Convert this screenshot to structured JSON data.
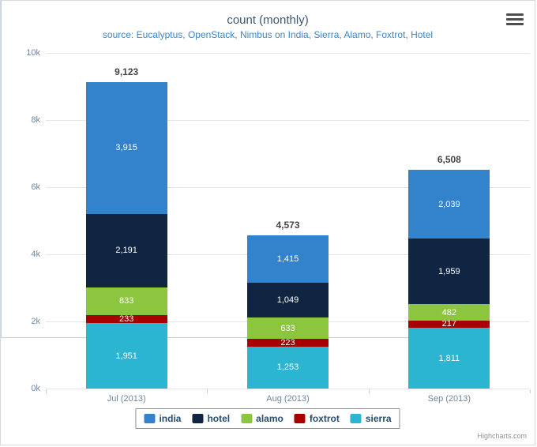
{
  "chart_data": {
    "type": "bar",
    "stacked": true,
    "title": "count (monthly)",
    "subtitle": "source: Eucalyptus, OpenStack, Nimbus on India, Sierra, Alamo, Foxtrot, Hotel",
    "xlabel": "",
    "ylabel": "",
    "categories": [
      "Jul (2013)",
      "Aug (2013)",
      "Sep (2013)"
    ],
    "ylim": [
      0,
      10000
    ],
    "yticks": [
      0,
      2000,
      4000,
      6000,
      8000,
      10000
    ],
    "ytick_labels": [
      "0k",
      "2k",
      "4k",
      "6k",
      "8k",
      "10k"
    ],
    "grid": true,
    "legend_position": "bottom",
    "totals": [
      9123,
      4573,
      6508
    ],
    "total_labels": [
      "9,123",
      "4,573",
      "6,508"
    ],
    "series": [
      {
        "name": "india",
        "color": "#3382cc",
        "values": [
          3915,
          1415,
          2039
        ],
        "labels": [
          "3,915",
          "1,415",
          "2,039"
        ]
      },
      {
        "name": "hotel",
        "color": "#102542",
        "values": [
          2191,
          1049,
          1959
        ],
        "labels": [
          "2,191",
          "1,049",
          "1,959"
        ]
      },
      {
        "name": "alamo",
        "color": "#8cc63e",
        "values": [
          833,
          633,
          482
        ],
        "labels": [
          "833",
          "633",
          "482"
        ]
      },
      {
        "name": "foxtrot",
        "color": "#a60000",
        "values": [
          233,
          223,
          217
        ],
        "labels": [
          "233",
          "223",
          "217"
        ]
      },
      {
        "name": "sierra",
        "color": "#2bb5d1",
        "values": [
          1951,
          1253,
          1811
        ],
        "labels": [
          "1,951",
          "1,253",
          "1,811"
        ]
      }
    ]
  },
  "menu": {
    "icon": "hamburger-menu-icon"
  },
  "credits": {
    "text": "Highcharts.com"
  }
}
